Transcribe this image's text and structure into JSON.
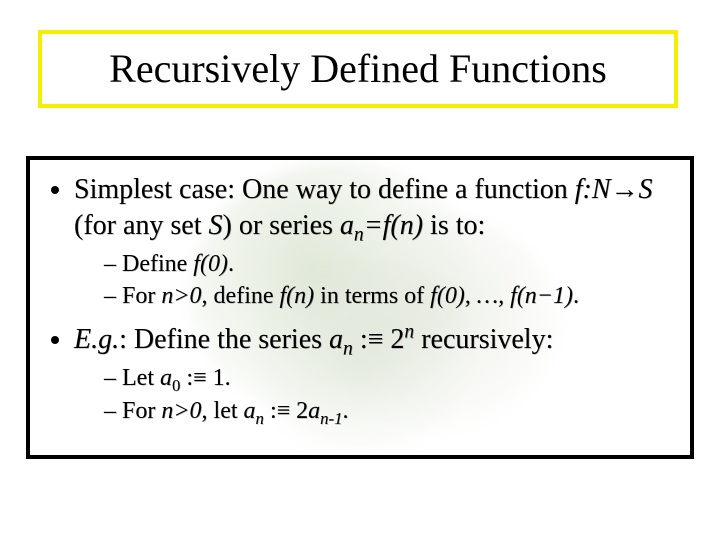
{
  "title": "Recursively Defined Functions",
  "bullet1": {
    "pre": "Simplest case: One way to define a function ",
    "fNS": "f:N→S",
    "mid1": " (for any set ",
    "S": "S",
    "mid2": ") or series ",
    "an": "a",
    "nsub": "n",
    "eq": "=f(n)",
    "post": " is to:"
  },
  "sub1a": {
    "pre": "Define ",
    "f0": "f(0)",
    "post": "."
  },
  "sub1b": {
    "pre": "For ",
    "cond": "n>0",
    "mid": ", define ",
    "fn": "f(n)",
    "mid2": " in terms of ",
    "f0": "f(0), …, f(n−1)",
    "post": "."
  },
  "bullet2": {
    "pre": "E.g.",
    "mid1": ": Define the series ",
    "an": "a",
    "nsub": "n",
    "mid2": " :≡ 2",
    "nsup": "n",
    "post": " recursively:"
  },
  "sub2a": {
    "pre": "Let ",
    "a": "a",
    "sub0": "0",
    "post": " :≡ 1."
  },
  "sub2b": {
    "pre": "For ",
    "cond": "n>0",
    "mid": ", let ",
    "a": "a",
    "subn": "n",
    "mid2": " :≡ 2",
    "a2": "a",
    "subn1": "n-1",
    "post": "."
  }
}
